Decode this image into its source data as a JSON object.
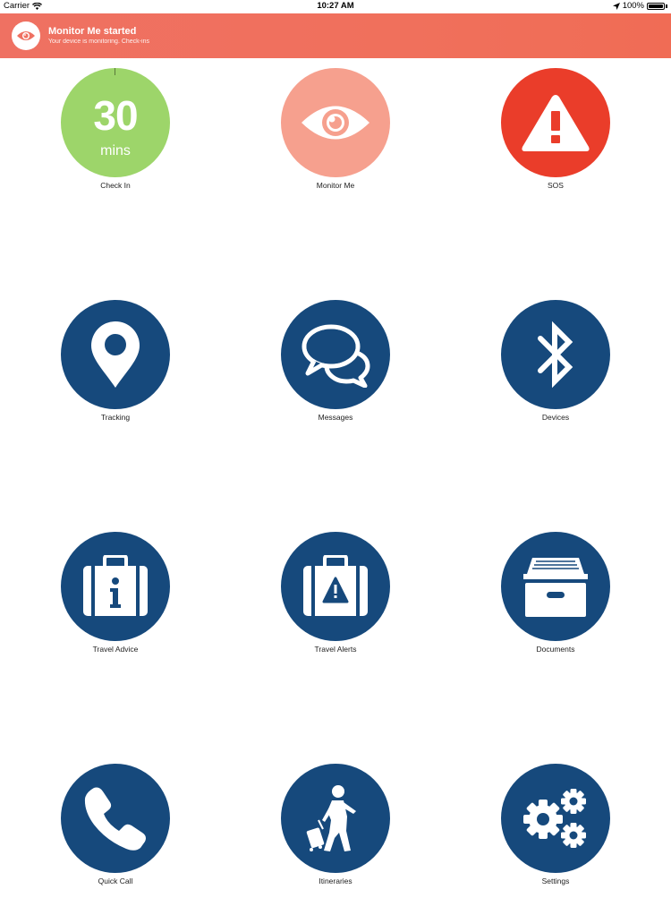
{
  "status_bar": {
    "carrier": "Carrier",
    "time": "10:27 AM",
    "battery": "100%"
  },
  "banner": {
    "title": "Monitor Me started",
    "subtitle": "Your device is monitoring. Check-ins",
    "icon": "eye-icon"
  },
  "colors": {
    "banner": "#f0705c",
    "check_in": "#9dd56a",
    "monitor_me": "#f6a08e",
    "sos": "#ea3d2a",
    "tile_navy": "#16497c"
  },
  "check_in": {
    "value": "30",
    "unit": "mins"
  },
  "tiles": [
    {
      "label": "Check In",
      "icon": "timer-icon"
    },
    {
      "label": "Monitor Me",
      "icon": "eye-icon"
    },
    {
      "label": "SOS",
      "icon": "warning-icon"
    },
    {
      "label": "Tracking",
      "icon": "location-pin-icon"
    },
    {
      "label": "Messages",
      "icon": "chat-bubbles-icon"
    },
    {
      "label": "Devices",
      "icon": "bluetooth-icon"
    },
    {
      "label": "Travel Advice",
      "icon": "briefcase-info-icon"
    },
    {
      "label": "Travel Alerts",
      "icon": "briefcase-alert-icon"
    },
    {
      "label": "Documents",
      "icon": "archive-box-icon"
    },
    {
      "label": "Quick Call",
      "icon": "phone-icon"
    },
    {
      "label": "Itineraries",
      "icon": "traveler-icon"
    },
    {
      "label": "Settings",
      "icon": "gears-icon"
    }
  ]
}
